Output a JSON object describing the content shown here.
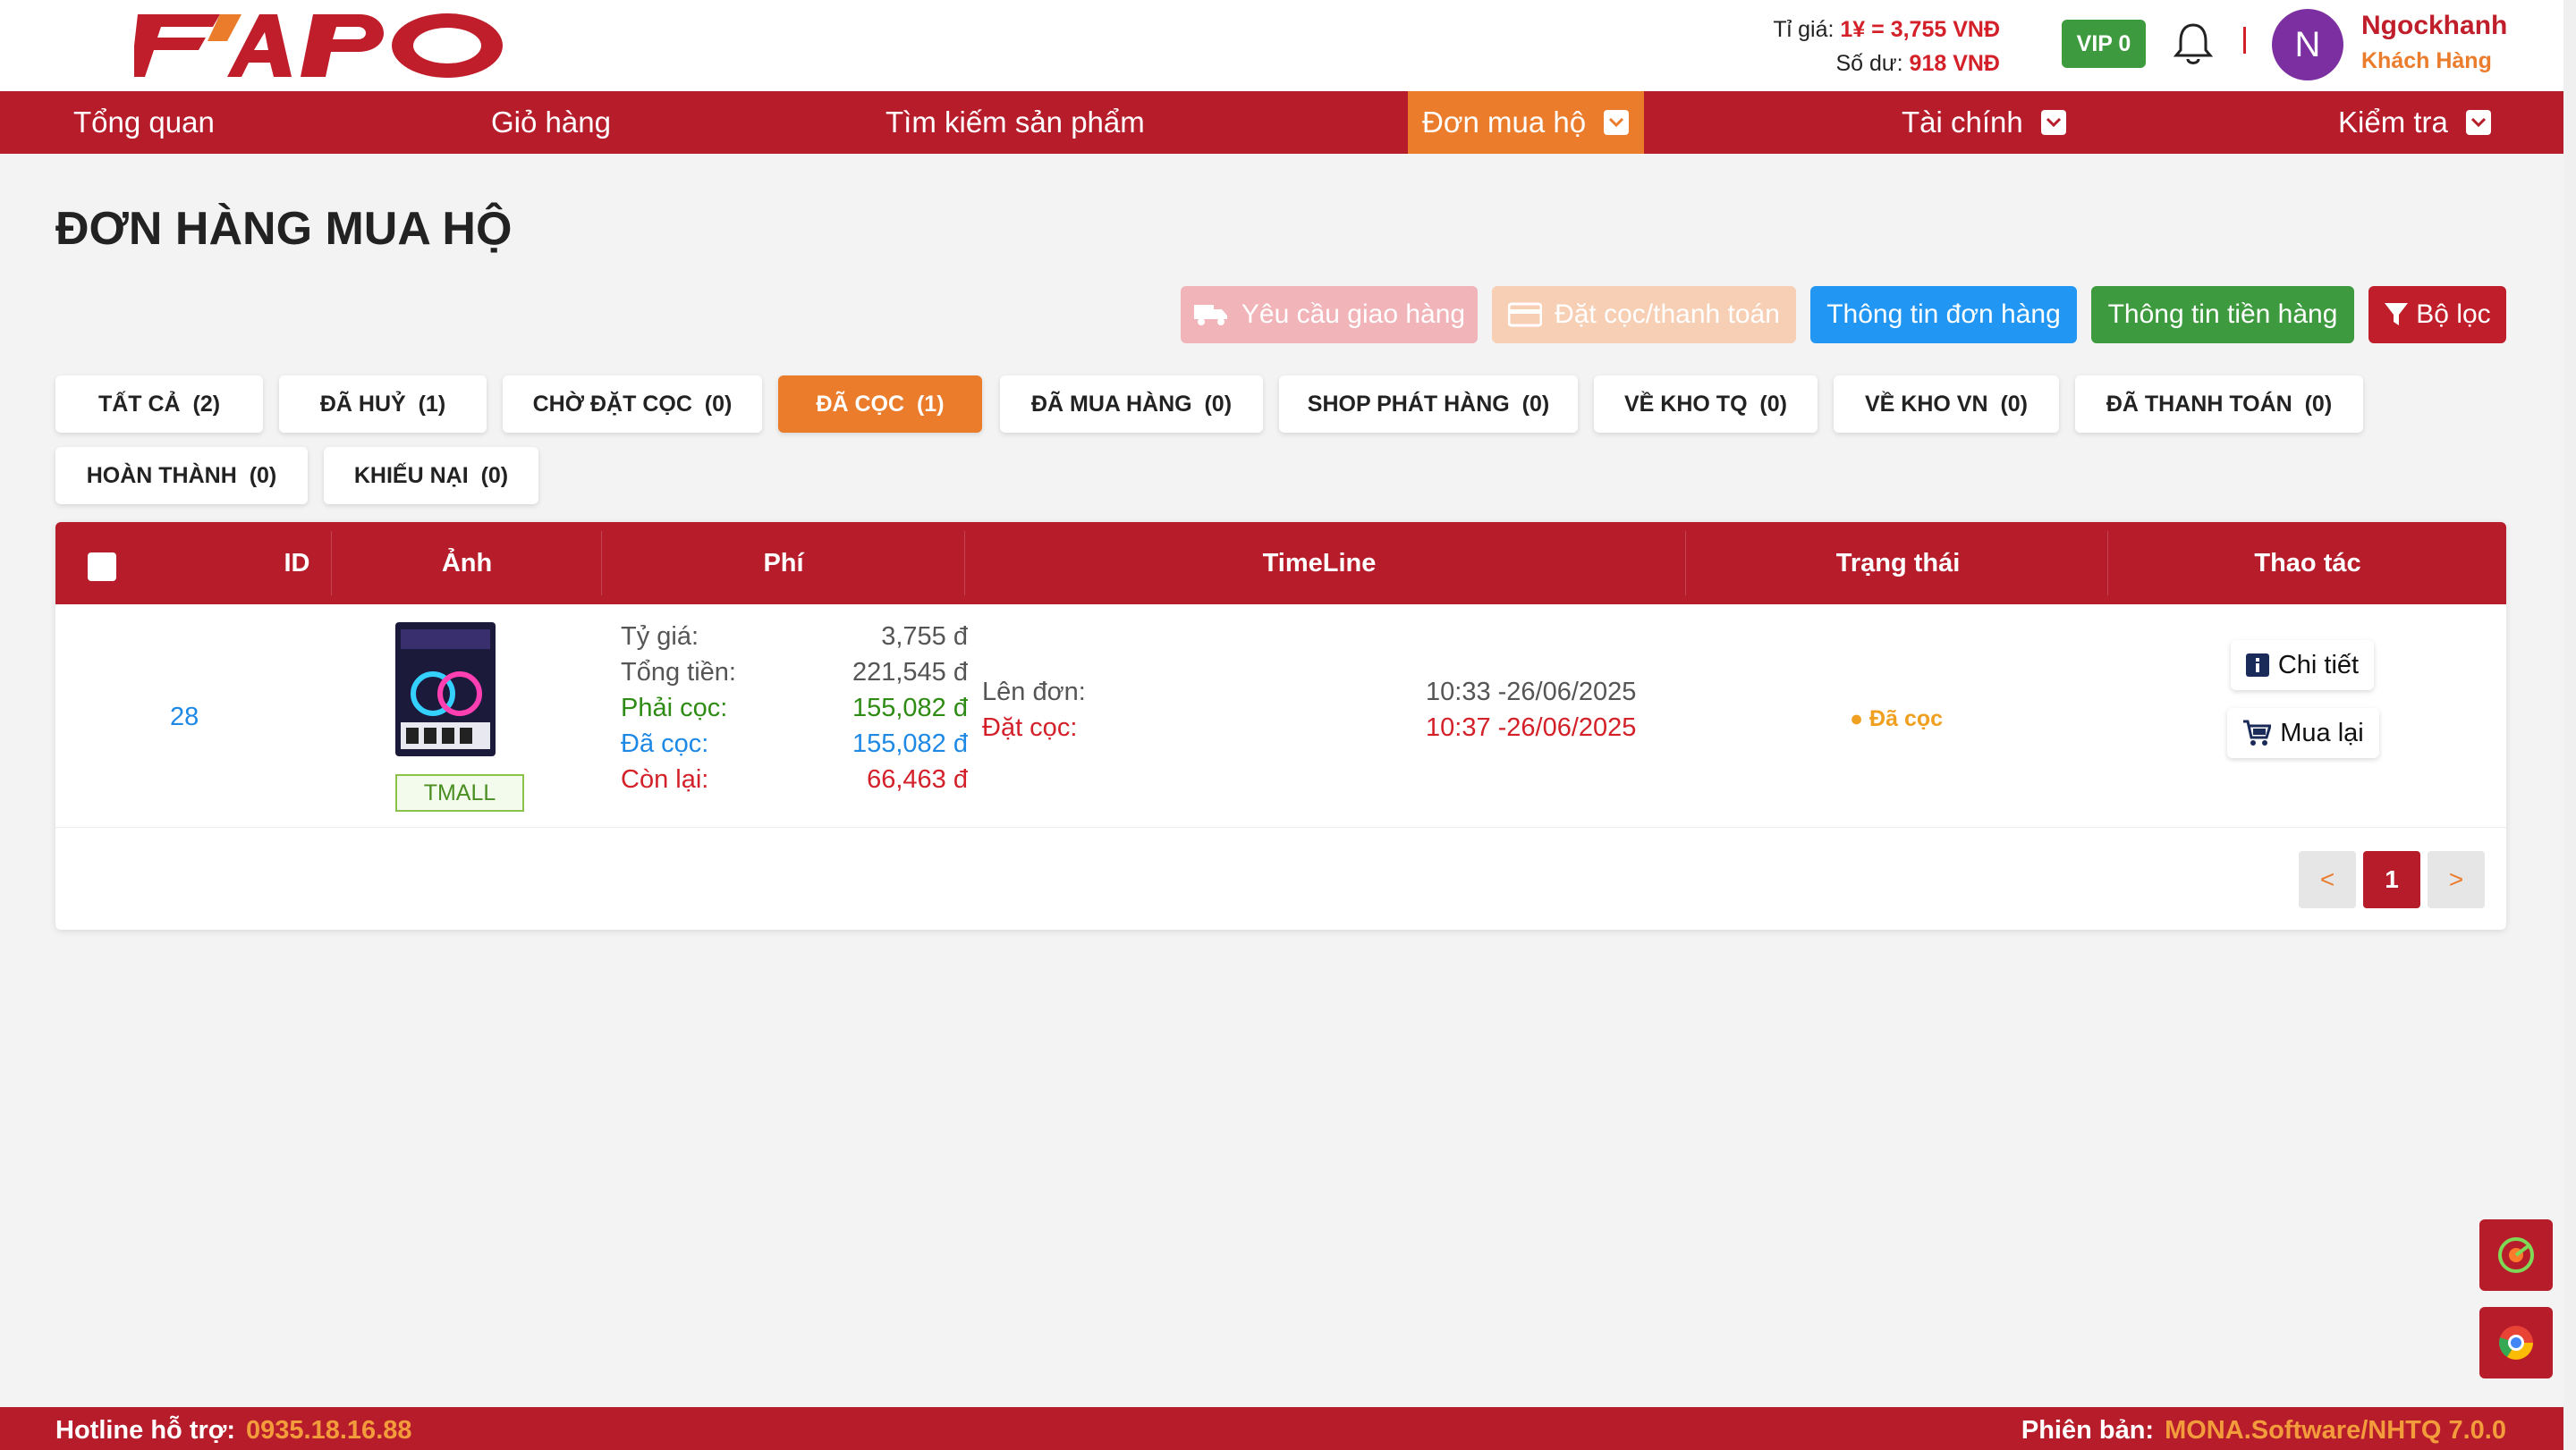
{
  "header": {
    "logo_text": "FAPO",
    "rate_label": "Tỉ giá:",
    "rate_value": "1¥ = 3,755 VNĐ",
    "balance_label": "Số dư:",
    "balance_value": "918 VNĐ",
    "vip": "VIP 0",
    "avatar_letter": "N",
    "user_name": "Ngockhanh",
    "user_role": "Khách Hàng"
  },
  "nav": {
    "items": [
      {
        "label": "Tổng quan"
      },
      {
        "label": "Giỏ hàng"
      },
      {
        "label": "Tìm kiếm sản phẩm"
      },
      {
        "label": "Đơn mua hộ"
      },
      {
        "label": "Tài chính"
      },
      {
        "label": "Kiểm tra"
      }
    ]
  },
  "page": {
    "title": "ĐƠN HÀNG MUA HỘ"
  },
  "actions": {
    "request_delivery": "Yêu cầu giao hàng",
    "deposit_payment": "Đặt cọc/thanh toán",
    "order_info": "Thông tin đơn hàng",
    "money_info": "Thông tin tiền hàng",
    "filter": "Bộ lọc"
  },
  "tabs": [
    {
      "label": "TẤT CẢ",
      "count": "(2)"
    },
    {
      "label": "ĐÃ HUỶ",
      "count": "(1)"
    },
    {
      "label": "CHỜ ĐẶT CỌC",
      "count": "(0)"
    },
    {
      "label": "ĐÃ CỌC",
      "count": "(1)"
    },
    {
      "label": "ĐÃ MUA HÀNG",
      "count": "(0)"
    },
    {
      "label": "SHOP PHÁT HÀNG",
      "count": "(0)"
    },
    {
      "label": "VỀ KHO TQ",
      "count": "(0)"
    },
    {
      "label": "VỀ KHO VN",
      "count": "(0)"
    },
    {
      "label": "ĐÃ THANH TOÁN",
      "count": "(0)"
    },
    {
      "label": "HOÀN THÀNH",
      "count": "(0)"
    },
    {
      "label": "KHIẾU NẠI",
      "count": "(0)"
    }
  ],
  "table": {
    "columns": [
      "ID",
      "Ảnh",
      "Phí",
      "TimeLine",
      "Trạng thái",
      "Thao tác"
    ],
    "rows": [
      {
        "id": "28",
        "tag": "TMALL",
        "fees": [
          {
            "label": "Tỷ giá:",
            "value": "3,755 đ"
          },
          {
            "label": "Tổng tiền:",
            "value": "221,545 đ"
          },
          {
            "label": "Phải cọc:",
            "value": "155,082 đ"
          },
          {
            "label": "Đã cọc:",
            "value": "155,082 đ"
          },
          {
            "label": "Còn lại:",
            "value": "66,463 đ"
          }
        ],
        "timeline": [
          {
            "label": "Lên đơn:",
            "value": "10:33 -26/06/2025"
          },
          {
            "label": "Đặt cọc:",
            "value": "10:37 -26/06/2025"
          }
        ],
        "status": "Đã cọc",
        "ops": {
          "detail": "Chi tiết",
          "rebuy": "Mua lại"
        }
      }
    ]
  },
  "pagination": {
    "prev": "<",
    "current": "1",
    "next": ">"
  },
  "footer": {
    "hotline_label": "Hotline hỗ trợ:",
    "hotline_value": "0935.18.16.88",
    "version_label": "Phiên bản:",
    "version_value": "MONA.Software/NHTQ 7.0.0"
  },
  "colors": {
    "brand_red": "#b71c2b",
    "accent_orange": "#ea7c2c",
    "blue": "#1e88e5",
    "green": "#3e9a3e"
  }
}
